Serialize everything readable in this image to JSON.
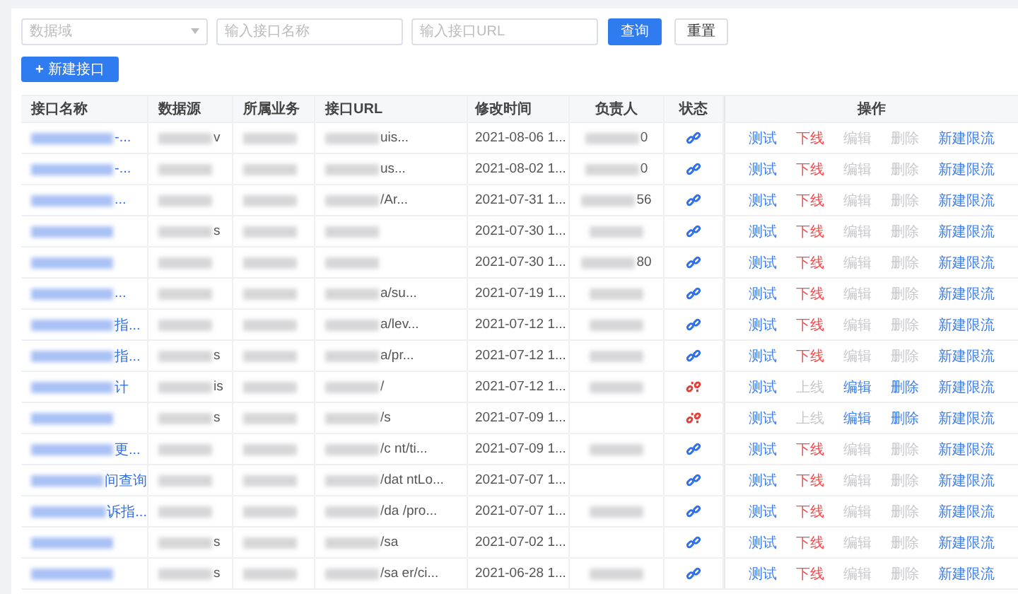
{
  "filters": {
    "domain_select": {
      "placeholder": "数据域"
    },
    "name_field": {
      "placeholder": "输入接口名称"
    },
    "url_field": {
      "placeholder": "输入接口URL"
    },
    "buttons": [
      {
        "label": "查询",
        "kind": "primary"
      },
      {
        "label": "重置",
        "kind": "default"
      }
    ]
  },
  "new_button": {
    "icon": "+",
    "label": "新建接口"
  },
  "table": {
    "columns": [
      "接口名称",
      "数据源",
      "所属业务",
      "接口URL",
      "修改时间",
      "负责人",
      "状态",
      "操作"
    ],
    "rows": [
      {
        "name": {
          "text": "-...",
          "redacted": true
        },
        "source": {
          "text": "v",
          "redacted": true
        },
        "business": {
          "redacted": true
        },
        "url": {
          "text": "uis...",
          "redacted": true
        },
        "time": "2021-08-06 1...",
        "owner": {
          "text": "0",
          "redacted": true
        },
        "online": true,
        "actions": [
          {
            "label": "测试",
            "disabled": false
          },
          {
            "label": "下线",
            "kind": "danger",
            "disabled": false
          },
          {
            "label": "编辑",
            "disabled": true
          },
          {
            "label": "删除",
            "disabled": true
          },
          {
            "label": "新建限流",
            "disabled": false
          }
        ]
      },
      {
        "name": {
          "text": "-...",
          "redacted": true
        },
        "source": {
          "redacted": true
        },
        "business": {
          "redacted": true
        },
        "url": {
          "text": "us...",
          "redacted": true
        },
        "time": "2021-08-02 1...",
        "owner": {
          "text": "0",
          "redacted": true
        },
        "online": true,
        "actions": [
          {
            "label": "测试",
            "disabled": false
          },
          {
            "label": "下线",
            "kind": "danger",
            "disabled": false
          },
          {
            "label": "编辑",
            "disabled": true
          },
          {
            "label": "删除",
            "disabled": true
          },
          {
            "label": "新建限流",
            "disabled": false
          }
        ]
      },
      {
        "name": {
          "text": "...",
          "redacted": true
        },
        "source": {
          "redacted": true
        },
        "business": {
          "redacted": true
        },
        "url": {
          "text": "/Ar...",
          "redacted": true
        },
        "time": "2021-07-31 1...",
        "owner": {
          "text": "56",
          "redacted": true
        },
        "online": true,
        "actions": [
          {
            "label": "测试",
            "disabled": false
          },
          {
            "label": "下线",
            "kind": "danger",
            "disabled": false
          },
          {
            "label": "编辑",
            "disabled": true
          },
          {
            "label": "删除",
            "disabled": true
          },
          {
            "label": "新建限流",
            "disabled": false
          }
        ]
      },
      {
        "name": {
          "redacted": true
        },
        "source": {
          "text": "s",
          "redacted": true
        },
        "business": {
          "redacted": true
        },
        "url": {
          "redacted": true
        },
        "time": "2021-07-30 1...",
        "owner": {
          "redacted": true
        },
        "online": true,
        "actions": [
          {
            "label": "测试",
            "disabled": false
          },
          {
            "label": "下线",
            "kind": "danger",
            "disabled": false
          },
          {
            "label": "编辑",
            "disabled": true
          },
          {
            "label": "删除",
            "disabled": true
          },
          {
            "label": "新建限流",
            "disabled": false
          }
        ]
      },
      {
        "name": {
          "redacted": true
        },
        "source": {
          "redacted": true
        },
        "business": {
          "redacted": true
        },
        "url": {
          "redacted": true
        },
        "time": "2021-07-30 1...",
        "owner": {
          "text": "80",
          "redacted": true
        },
        "online": true,
        "actions": [
          {
            "label": "测试",
            "disabled": false
          },
          {
            "label": "下线",
            "kind": "danger",
            "disabled": false
          },
          {
            "label": "编辑",
            "disabled": true
          },
          {
            "label": "删除",
            "disabled": true
          },
          {
            "label": "新建限流",
            "disabled": false
          }
        ]
      },
      {
        "name": {
          "text": "...",
          "redacted": true
        },
        "source": {
          "redacted": true
        },
        "business": {
          "redacted": true
        },
        "url": {
          "text": "a/su...",
          "redacted": true
        },
        "time": "2021-07-19 1...",
        "owner": {
          "redacted": true
        },
        "online": true,
        "actions": [
          {
            "label": "测试",
            "disabled": false
          },
          {
            "label": "下线",
            "kind": "danger",
            "disabled": false
          },
          {
            "label": "编辑",
            "disabled": true
          },
          {
            "label": "删除",
            "disabled": true
          },
          {
            "label": "新建限流",
            "disabled": false
          }
        ]
      },
      {
        "name": {
          "text": "指...",
          "redacted": true
        },
        "source": {
          "redacted": true
        },
        "business": {
          "redacted": true
        },
        "url": {
          "text": "a/lev...",
          "redacted": true
        },
        "time": "2021-07-12 1...",
        "owner": {
          "redacted": true
        },
        "online": true,
        "actions": [
          {
            "label": "测试",
            "disabled": false
          },
          {
            "label": "下线",
            "kind": "danger",
            "disabled": false
          },
          {
            "label": "编辑",
            "disabled": true
          },
          {
            "label": "删除",
            "disabled": true
          },
          {
            "label": "新建限流",
            "disabled": false
          }
        ]
      },
      {
        "name": {
          "text": "指...",
          "redacted": true
        },
        "source": {
          "text": "s",
          "redacted": true
        },
        "business": {
          "redacted": true
        },
        "url": {
          "text": "a/pr...",
          "redacted": true
        },
        "time": "2021-07-12 1...",
        "owner": {
          "redacted": true
        },
        "online": true,
        "actions": [
          {
            "label": "测试",
            "disabled": false
          },
          {
            "label": "下线",
            "kind": "danger",
            "disabled": false
          },
          {
            "label": "编辑",
            "disabled": true
          },
          {
            "label": "删除",
            "disabled": true
          },
          {
            "label": "新建限流",
            "disabled": false
          }
        ]
      },
      {
        "name": {
          "text": "计",
          "redacted": true
        },
        "source": {
          "text": "is",
          "redacted": true
        },
        "business": {
          "redacted": true
        },
        "url": {
          "text": "/",
          "redacted": true
        },
        "time": "2021-07-12 1...",
        "owner": {
          "redacted": true
        },
        "online": false,
        "actions": [
          {
            "label": "测试",
            "disabled": false
          },
          {
            "label": "上线",
            "disabled": true
          },
          {
            "label": "编辑",
            "disabled": false
          },
          {
            "label": "删除",
            "disabled": false
          },
          {
            "label": "新建限流",
            "disabled": false
          }
        ]
      },
      {
        "name": {
          "redacted": true
        },
        "source": {
          "text": "s",
          "redacted": true
        },
        "business": {
          "redacted": true
        },
        "url": {
          "text": "/s",
          "redacted": true
        },
        "time": "2021-07-09 1...",
        "online": false,
        "actions": [
          {
            "label": "测试",
            "disabled": false
          },
          {
            "label": "上线",
            "disabled": true
          },
          {
            "label": "编辑",
            "disabled": false
          },
          {
            "label": "删除",
            "disabled": false
          },
          {
            "label": "新建限流",
            "disabled": false
          }
        ]
      },
      {
        "name": {
          "text": "更...",
          "redacted": true
        },
        "source": {
          "redacted": true
        },
        "business": {
          "redacted": true
        },
        "url": {
          "text": "/c nt/ti...",
          "redacted": true
        },
        "time": "2021-07-09 1...",
        "owner": {
          "redacted": true
        },
        "online": true,
        "actions": [
          {
            "label": "测试",
            "disabled": false
          },
          {
            "label": "下线",
            "kind": "danger",
            "disabled": false
          },
          {
            "label": "编辑",
            "disabled": true
          },
          {
            "label": "删除",
            "disabled": true
          },
          {
            "label": "新建限流",
            "disabled": false
          }
        ]
      },
      {
        "name": {
          "text": "间查询",
          "redacted": true
        },
        "source": {
          "redacted": true
        },
        "business": {
          "redacted": true
        },
        "url": {
          "text": "/dat ntLo...",
          "redacted": true
        },
        "time": "2021-07-07 1...",
        "online": true,
        "actions": [
          {
            "label": "测试",
            "disabled": false
          },
          {
            "label": "下线",
            "kind": "danger",
            "disabled": false
          },
          {
            "label": "编辑",
            "disabled": true
          },
          {
            "label": "删除",
            "disabled": true
          },
          {
            "label": "新建限流",
            "disabled": false
          }
        ]
      },
      {
        "name": {
          "text": "诉指...",
          "redacted": true
        },
        "source": {
          "redacted": true
        },
        "business": {
          "redacted": true
        },
        "url": {
          "text": "/da /pro...",
          "redacted": true
        },
        "time": "2021-07-07 1...",
        "owner": {
          "redacted": true
        },
        "online": true,
        "actions": [
          {
            "label": "测试",
            "disabled": false
          },
          {
            "label": "下线",
            "kind": "danger",
            "disabled": false
          },
          {
            "label": "编辑",
            "disabled": true
          },
          {
            "label": "删除",
            "disabled": true
          },
          {
            "label": "新建限流",
            "disabled": false
          }
        ]
      },
      {
        "name": {
          "redacted": true
        },
        "source": {
          "text": "s",
          "redacted": true
        },
        "business": {
          "redacted": true
        },
        "url": {
          "text": "/sa",
          "redacted": true
        },
        "time": "2021-07-02 1...",
        "online": true,
        "actions": [
          {
            "label": "测试",
            "disabled": false
          },
          {
            "label": "下线",
            "kind": "danger",
            "disabled": false
          },
          {
            "label": "编辑",
            "disabled": true
          },
          {
            "label": "删除",
            "disabled": true
          },
          {
            "label": "新建限流",
            "disabled": false
          }
        ]
      },
      {
        "name": {
          "redacted": true
        },
        "source": {
          "text": "s",
          "redacted": true
        },
        "business": {
          "redacted": true
        },
        "url": {
          "text": "/sa er/ci...",
          "redacted": true
        },
        "time": "2021-06-28 1...",
        "owner": {
          "redacted": true
        },
        "online": true,
        "actions": [
          {
            "label": "测试",
            "disabled": false
          },
          {
            "label": "下线",
            "kind": "danger",
            "disabled": false
          },
          {
            "label": "编辑",
            "disabled": true
          },
          {
            "label": "删除",
            "disabled": true
          },
          {
            "label": "新建限流",
            "disabled": false
          }
        ]
      }
    ]
  }
}
